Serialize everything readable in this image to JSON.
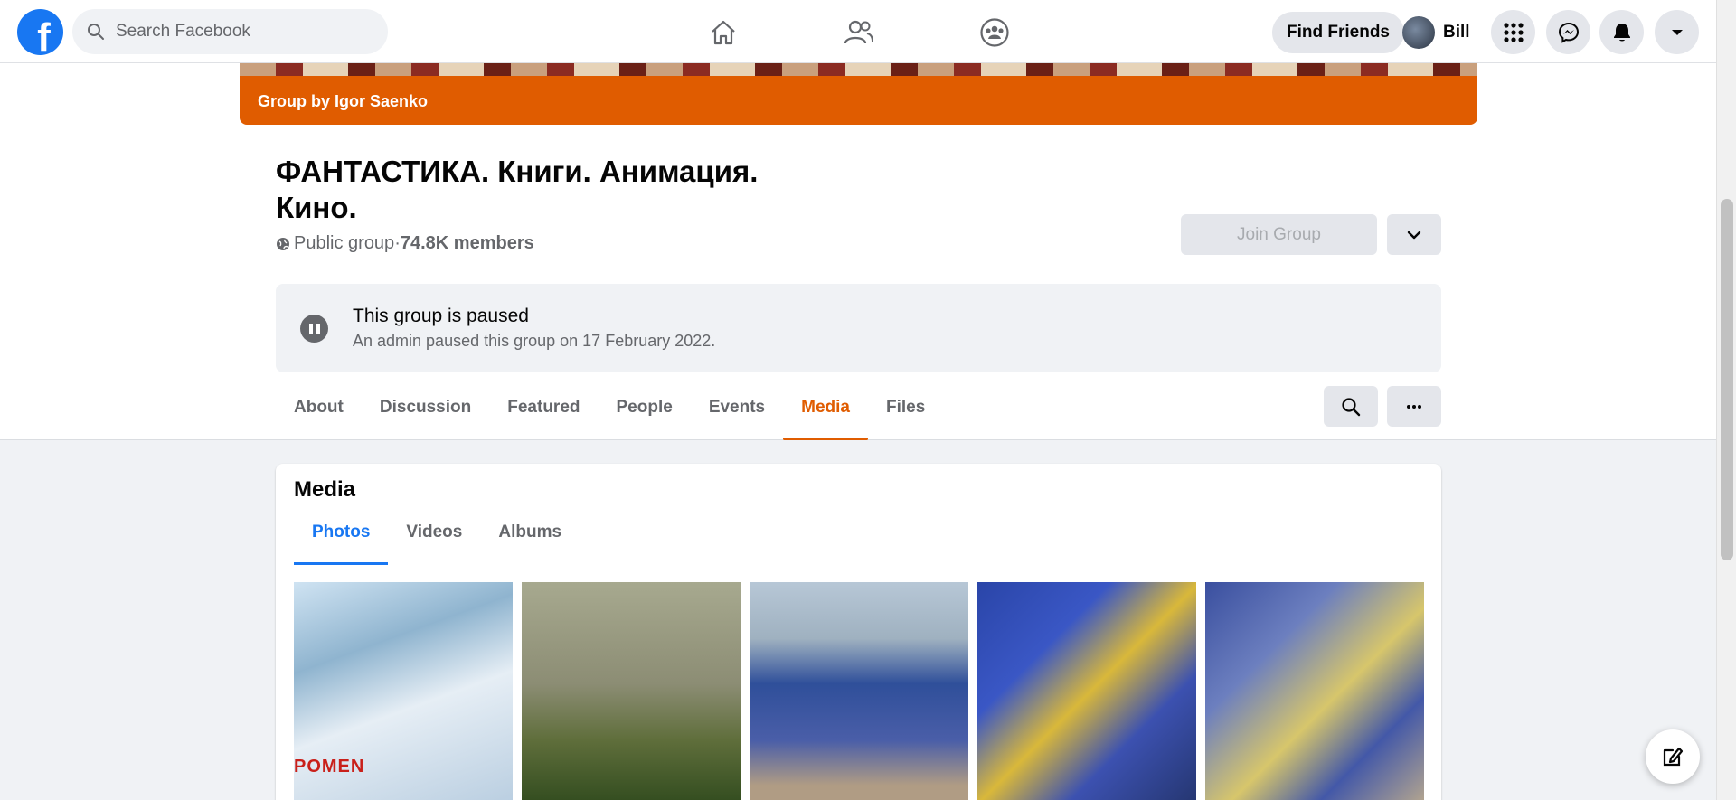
{
  "nav": {
    "logo": "f",
    "search_placeholder": "Search Facebook",
    "find_friends": "Find Friends",
    "profile_name": "Bill"
  },
  "group": {
    "banner": "Group by Igor Saenko",
    "title": "ФАНТАСТИКА. Книги. Анимация. Кино.",
    "privacy": "Public group",
    "separator": " · ",
    "members": "74.8K members",
    "join_label": "Join Group"
  },
  "paused": {
    "title": "This group is paused",
    "subtitle": "An admin paused this group on 17 February 2022."
  },
  "tabs": [
    "About",
    "Discussion",
    "Featured",
    "People",
    "Events",
    "Media",
    "Files"
  ],
  "active_tab": "Media",
  "media": {
    "title": "Media",
    "subtabs": [
      "Photos",
      "Videos",
      "Albums"
    ],
    "active_subtab": "Photos",
    "thumb1_text": "POMEN"
  },
  "colors": {
    "accent": "#e05c00",
    "brand": "#1877f2"
  }
}
